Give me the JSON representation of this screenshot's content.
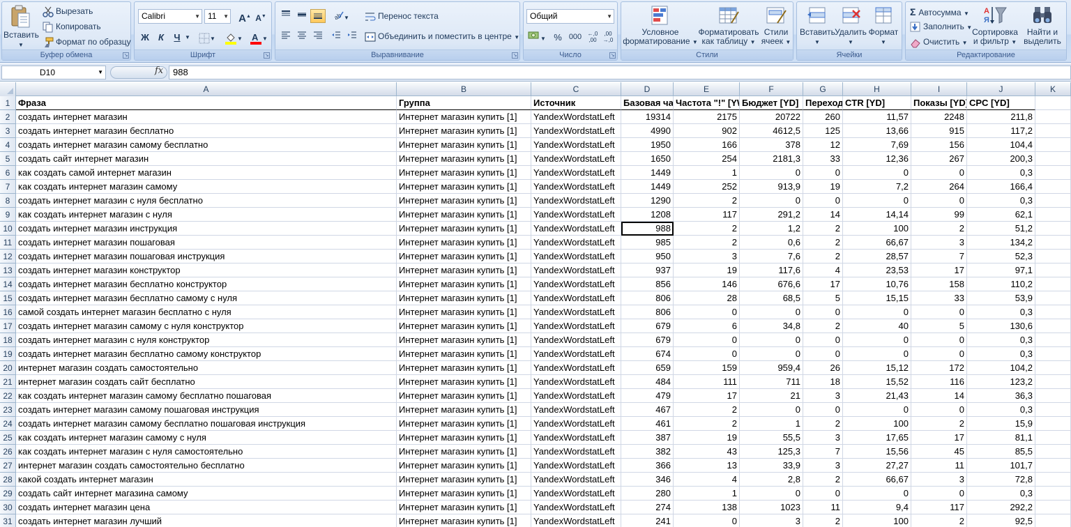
{
  "ribbon": {
    "clipboard": {
      "title": "Буфер обмена",
      "paste": "Вставить",
      "cut": "Вырезать",
      "copy": "Копировать",
      "format_painter": "Формат по образцу"
    },
    "font": {
      "title": "Шрифт",
      "font_name": "Calibri",
      "font_size": "11",
      "grow": "A",
      "shrink": "A",
      "bold": "Ж",
      "italic": "К",
      "underline": "Ч"
    },
    "alignment": {
      "title": "Выравнивание",
      "wrap_text": "Перенос текста",
      "merge_center": "Объединить и поместить в центре"
    },
    "number": {
      "title": "Число",
      "format": "Общий",
      "percent": "%",
      "thousands": "000",
      "inc_decimal": "←,0 ,00",
      "dec_decimal": ",00 →,0"
    },
    "styles": {
      "title": "Стили",
      "conditional_line1": "Условное",
      "conditional_line2": "форматирование",
      "table_line1": "Форматировать",
      "table_line2": "как таблицу",
      "cell_styles_line1": "Стили",
      "cell_styles_line2": "ячеек"
    },
    "cells": {
      "title": "Ячейки",
      "insert": "Вставить",
      "delete": "Удалить",
      "format": "Формат"
    },
    "editing": {
      "title": "Редактирование",
      "autosum": "Автосумма",
      "fill": "Заполнить",
      "clear": "Очистить",
      "sort_line1": "Сортировка",
      "sort_line2": "и фильтр",
      "find_line1": "Найти и",
      "find_line2": "выделить"
    }
  },
  "formula_bar": {
    "name_box": "D10",
    "fx": "fx",
    "formula": "988"
  },
  "sheet": {
    "columns": [
      "A",
      "B",
      "C",
      "D",
      "E",
      "F",
      "G",
      "H",
      "I",
      "J",
      "K"
    ],
    "header_row_number": "1",
    "headers": [
      "Фраза",
      "Группа",
      "Источник",
      "Базовая частота",
      "Частота \"!\" [YW]",
      "Бюджет [YD]",
      "Переходы",
      "CTR [YD]",
      "Показы [YD]",
      "CPC [YD]"
    ],
    "rows": [
      {
        "n": "2",
        "cells": [
          "создать интернет магазин",
          "Интернет магазин купить [1]",
          "YandexWordstatLeft",
          "19314",
          "2175",
          "20722",
          "260",
          "11,57",
          "2248",
          "211,8"
        ]
      },
      {
        "n": "3",
        "cells": [
          "создать интернет магазин бесплатно",
          "Интернет магазин купить [1]",
          "YandexWordstatLeft",
          "4990",
          "902",
          "4612,5",
          "125",
          "13,66",
          "915",
          "117,2"
        ]
      },
      {
        "n": "4",
        "cells": [
          "создать интернет магазин самому бесплатно",
          "Интернет магазин купить [1]",
          "YandexWordstatLeft",
          "1950",
          "166",
          "378",
          "12",
          "7,69",
          "156",
          "104,4"
        ]
      },
      {
        "n": "5",
        "cells": [
          "создать сайт интернет магазин",
          "Интернет магазин купить [1]",
          "YandexWordstatLeft",
          "1650",
          "254",
          "2181,3",
          "33",
          "12,36",
          "267",
          "200,3"
        ]
      },
      {
        "n": "6",
        "cells": [
          "как создать самой интернет магазин",
          "Интернет магазин купить [1]",
          "YandexWordstatLeft",
          "1449",
          "1",
          "0",
          "0",
          "0",
          "0",
          "0,3"
        ]
      },
      {
        "n": "7",
        "cells": [
          "как создать интернет магазин самому",
          "Интернет магазин купить [1]",
          "YandexWordstatLeft",
          "1449",
          "252",
          "913,9",
          "19",
          "7,2",
          "264",
          "166,4"
        ]
      },
      {
        "n": "8",
        "cells": [
          "создать интернет магазин с нуля бесплатно",
          "Интернет магазин купить [1]",
          "YandexWordstatLeft",
          "1290",
          "2",
          "0",
          "0",
          "0",
          "0",
          "0,3"
        ]
      },
      {
        "n": "9",
        "cells": [
          "как создать интернет магазин с нуля",
          "Интернет магазин купить [1]",
          "YandexWordstatLeft",
          "1208",
          "117",
          "291,2",
          "14",
          "14,14",
          "99",
          "62,1"
        ]
      },
      {
        "n": "10",
        "cells": [
          "создать интернет магазин инструкция",
          "Интернет магазин купить [1]",
          "YandexWordstatLeft",
          "988",
          "2",
          "1,2",
          "2",
          "100",
          "2",
          "51,2"
        ]
      },
      {
        "n": "11",
        "cells": [
          "создать интернет магазин пошаговая",
          "Интернет магазин купить [1]",
          "YandexWordstatLeft",
          "985",
          "2",
          "0,6",
          "2",
          "66,67",
          "3",
          "134,2"
        ]
      },
      {
        "n": "12",
        "cells": [
          "создать интернет магазин пошаговая инструкция",
          "Интернет магазин купить [1]",
          "YandexWordstatLeft",
          "950",
          "3",
          "7,6",
          "2",
          "28,57",
          "7",
          "52,3"
        ]
      },
      {
        "n": "13",
        "cells": [
          "создать интернет магазин конструктор",
          "Интернет магазин купить [1]",
          "YandexWordstatLeft",
          "937",
          "19",
          "117,6",
          "4",
          "23,53",
          "17",
          "97,1"
        ]
      },
      {
        "n": "14",
        "cells": [
          "создать интернет магазин бесплатно конструктор",
          "Интернет магазин купить [1]",
          "YandexWordstatLeft",
          "856",
          "146",
          "676,6",
          "17",
          "10,76",
          "158",
          "110,2"
        ]
      },
      {
        "n": "15",
        "cells": [
          "создать интернет магазин бесплатно самому с нуля",
          "Интернет магазин купить [1]",
          "YandexWordstatLeft",
          "806",
          "28",
          "68,5",
          "5",
          "15,15",
          "33",
          "53,9"
        ]
      },
      {
        "n": "16",
        "cells": [
          "самой создать интернет магазин бесплатно с нуля",
          "Интернет магазин купить [1]",
          "YandexWordstatLeft",
          "806",
          "0",
          "0",
          "0",
          "0",
          "0",
          "0,3"
        ]
      },
      {
        "n": "17",
        "cells": [
          "создать интернет магазин самому с нуля конструктор",
          "Интернет магазин купить [1]",
          "YandexWordstatLeft",
          "679",
          "6",
          "34,8",
          "2",
          "40",
          "5",
          "130,6"
        ]
      },
      {
        "n": "18",
        "cells": [
          "создать интернет магазин с нуля конструктор",
          "Интернет магазин купить [1]",
          "YandexWordstatLeft",
          "679",
          "0",
          "0",
          "0",
          "0",
          "0",
          "0,3"
        ]
      },
      {
        "n": "19",
        "cells": [
          "создать интернет магазин бесплатно самому конструктор",
          "Интернет магазин купить [1]",
          "YandexWordstatLeft",
          "674",
          "0",
          "0",
          "0",
          "0",
          "0",
          "0,3"
        ]
      },
      {
        "n": "20",
        "cells": [
          "интернет магазин создать самостоятельно",
          "Интернет магазин купить [1]",
          "YandexWordstatLeft",
          "659",
          "159",
          "959,4",
          "26",
          "15,12",
          "172",
          "104,2"
        ]
      },
      {
        "n": "21",
        "cells": [
          "интернет магазин создать сайт бесплатно",
          "Интернет магазин купить [1]",
          "YandexWordstatLeft",
          "484",
          "111",
          "711",
          "18",
          "15,52",
          "116",
          "123,2"
        ]
      },
      {
        "n": "22",
        "cells": [
          "как создать интернет магазин самому бесплатно пошаговая",
          "Интернет магазин купить [1]",
          "YandexWordstatLeft",
          "479",
          "17",
          "21",
          "3",
          "21,43",
          "14",
          "36,3"
        ]
      },
      {
        "n": "23",
        "cells": [
          "создать интернет магазин самому пошаговая инструкция",
          "Интернет магазин купить [1]",
          "YandexWordstatLeft",
          "467",
          "2",
          "0",
          "0",
          "0",
          "0",
          "0,3"
        ]
      },
      {
        "n": "24",
        "cells": [
          "создать интернет магазин самому бесплатно пошаговая инструкция",
          "Интернет магазин купить [1]",
          "YandexWordstatLeft",
          "461",
          "2",
          "1",
          "2",
          "100",
          "2",
          "15,9"
        ]
      },
      {
        "n": "25",
        "cells": [
          "как создать интернет магазин самому с нуля",
          "Интернет магазин купить [1]",
          "YandexWordstatLeft",
          "387",
          "19",
          "55,5",
          "3",
          "17,65",
          "17",
          "81,1"
        ]
      },
      {
        "n": "26",
        "cells": [
          "как создать интернет магазин с нуля самостоятельно",
          "Интернет магазин купить [1]",
          "YandexWordstatLeft",
          "382",
          "43",
          "125,3",
          "7",
          "15,56",
          "45",
          "85,5"
        ]
      },
      {
        "n": "27",
        "cells": [
          "интернет магазин создать самостоятельно бесплатно",
          "Интернет магазин купить [1]",
          "YandexWordstatLeft",
          "366",
          "13",
          "33,9",
          "3",
          "27,27",
          "11",
          "101,7"
        ]
      },
      {
        "n": "28",
        "cells": [
          "какой создать интернет магазин",
          "Интернет магазин купить [1]",
          "YandexWordstatLeft",
          "346",
          "4",
          "2,8",
          "2",
          "66,67",
          "3",
          "72,8"
        ]
      },
      {
        "n": "29",
        "cells": [
          "создать сайт интернет магазина самому",
          "Интернет магазин купить [1]",
          "YandexWordstatLeft",
          "280",
          "1",
          "0",
          "0",
          "0",
          "0",
          "0,3"
        ]
      },
      {
        "n": "30",
        "cells": [
          "создать интернет магазин цена",
          "Интернет магазин купить [1]",
          "YandexWordstatLeft",
          "274",
          "138",
          "1023",
          "11",
          "9,4",
          "117",
          "292,2"
        ]
      },
      {
        "n": "31",
        "cells": [
          "создать интернет магазин лучший",
          "Интернет магазин купить [1]",
          "YandexWordstatLeft",
          "241",
          "0",
          "3",
          "2",
          "100",
          "2",
          "92,5"
        ]
      }
    ]
  }
}
